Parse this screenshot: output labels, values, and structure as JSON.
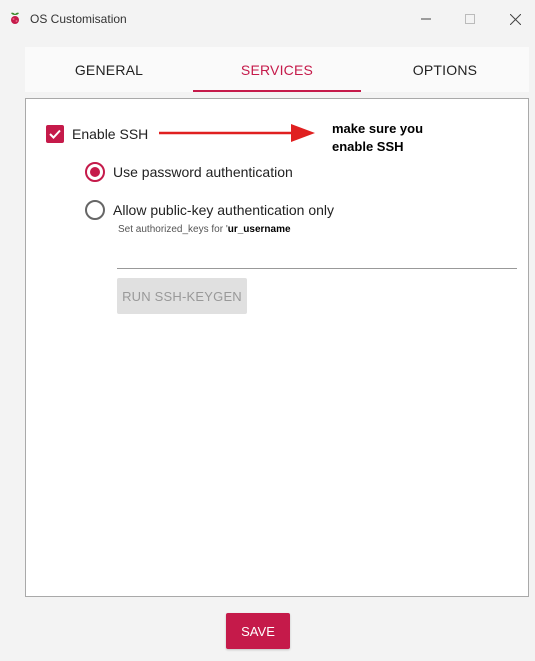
{
  "window": {
    "title": "OS Customisation",
    "controls": {
      "minimize": "minimize-icon",
      "maximize": "maximize-icon",
      "close": "close-icon"
    }
  },
  "tabs": [
    {
      "label": "GENERAL",
      "active": false
    },
    {
      "label": "SERVICES",
      "active": true
    },
    {
      "label": "OPTIONS",
      "active": false
    }
  ],
  "services": {
    "enable_ssh": {
      "label": "Enable SSH",
      "checked": true
    },
    "annotation": {
      "line1": "make sure you",
      "line2": "enable SSH"
    },
    "auth_password": {
      "label": "Use password authentication",
      "selected": true
    },
    "auth_pubkey": {
      "label": "Allow public-key authentication only",
      "selected": false
    },
    "authorized_keys_hint": {
      "prefix": "Set authorized_keys for '",
      "username": "ur_username"
    },
    "authorized_keys_value": "",
    "keygen_button": "RUN SSH-KEYGEN"
  },
  "footer": {
    "save_label": "SAVE"
  },
  "colors": {
    "accent": "#c51a4a",
    "annotation_arrow": "#e02020"
  }
}
